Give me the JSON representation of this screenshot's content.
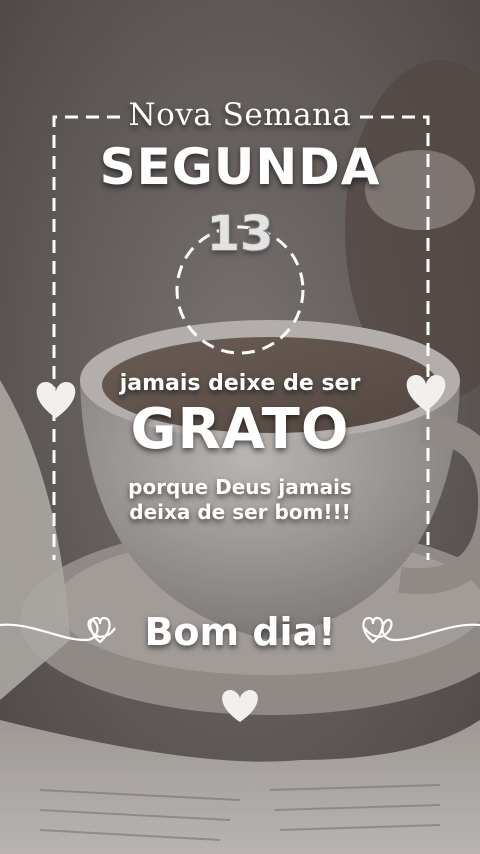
{
  "header": {
    "subtitle": "Nova Semana",
    "day": "SEGUNDA",
    "date": "13"
  },
  "message": {
    "line1": "jamais deixe de ser",
    "highlight": "GRATO",
    "line2": "porque Deus jamais",
    "line3": "deixa de ser bom!!!"
  },
  "footer": {
    "greeting": "Bom dia!"
  },
  "icons": [
    "heart-icon",
    "heart-outline-icon"
  ],
  "colors": {
    "text": "#ffffff",
    "background": "#6f6966"
  }
}
